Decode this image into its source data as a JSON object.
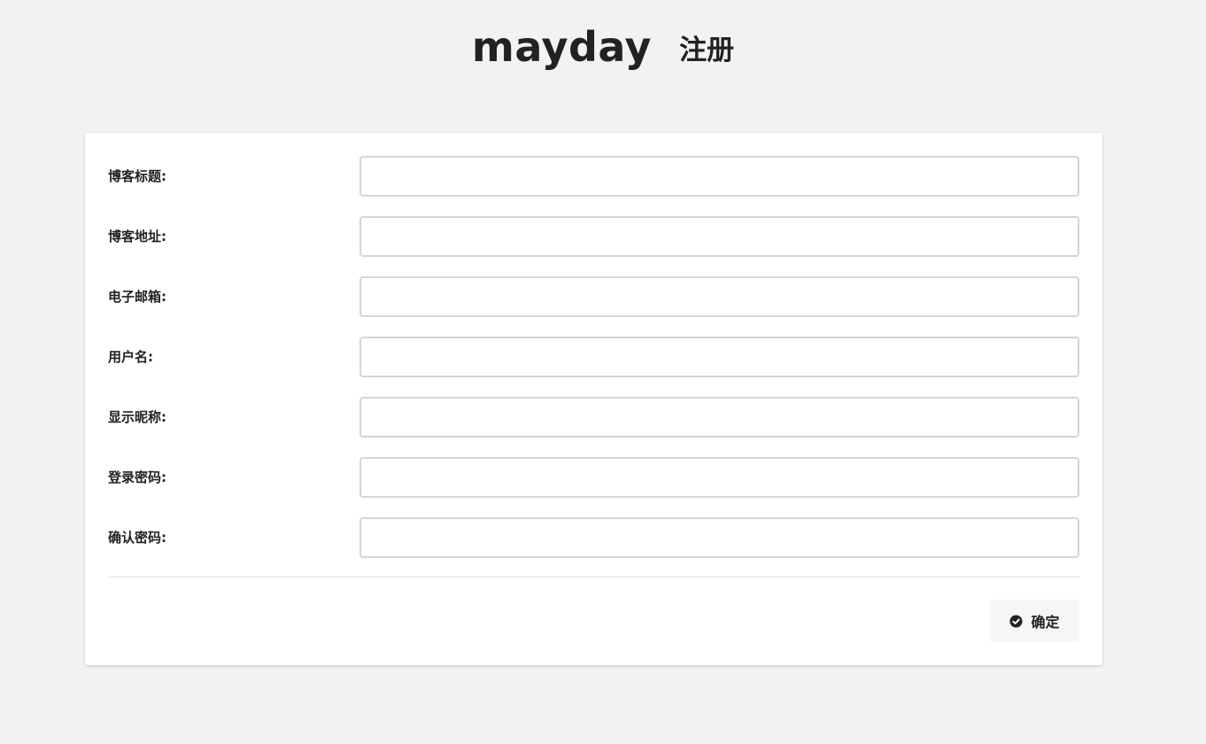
{
  "header": {
    "brand": "mayday",
    "subtitle": "注册"
  },
  "form": {
    "fields": [
      {
        "label": "博客标题:",
        "value": ""
      },
      {
        "label": "博客地址:",
        "value": ""
      },
      {
        "label": "电子邮箱:",
        "value": ""
      },
      {
        "label": "用户名:",
        "value": ""
      },
      {
        "label": "显示昵称:",
        "value": ""
      },
      {
        "label": "登录密码:",
        "value": ""
      },
      {
        "label": "确认密码:",
        "value": ""
      }
    ],
    "submit_label": "确定",
    "submit_icon": "check-circle-icon"
  },
  "colors": {
    "page_background": "#f2f2f2",
    "card_background": "#ffffff",
    "input_border": "#d4d4dc",
    "button_background": "#f5f6f7",
    "text": "#222222"
  }
}
